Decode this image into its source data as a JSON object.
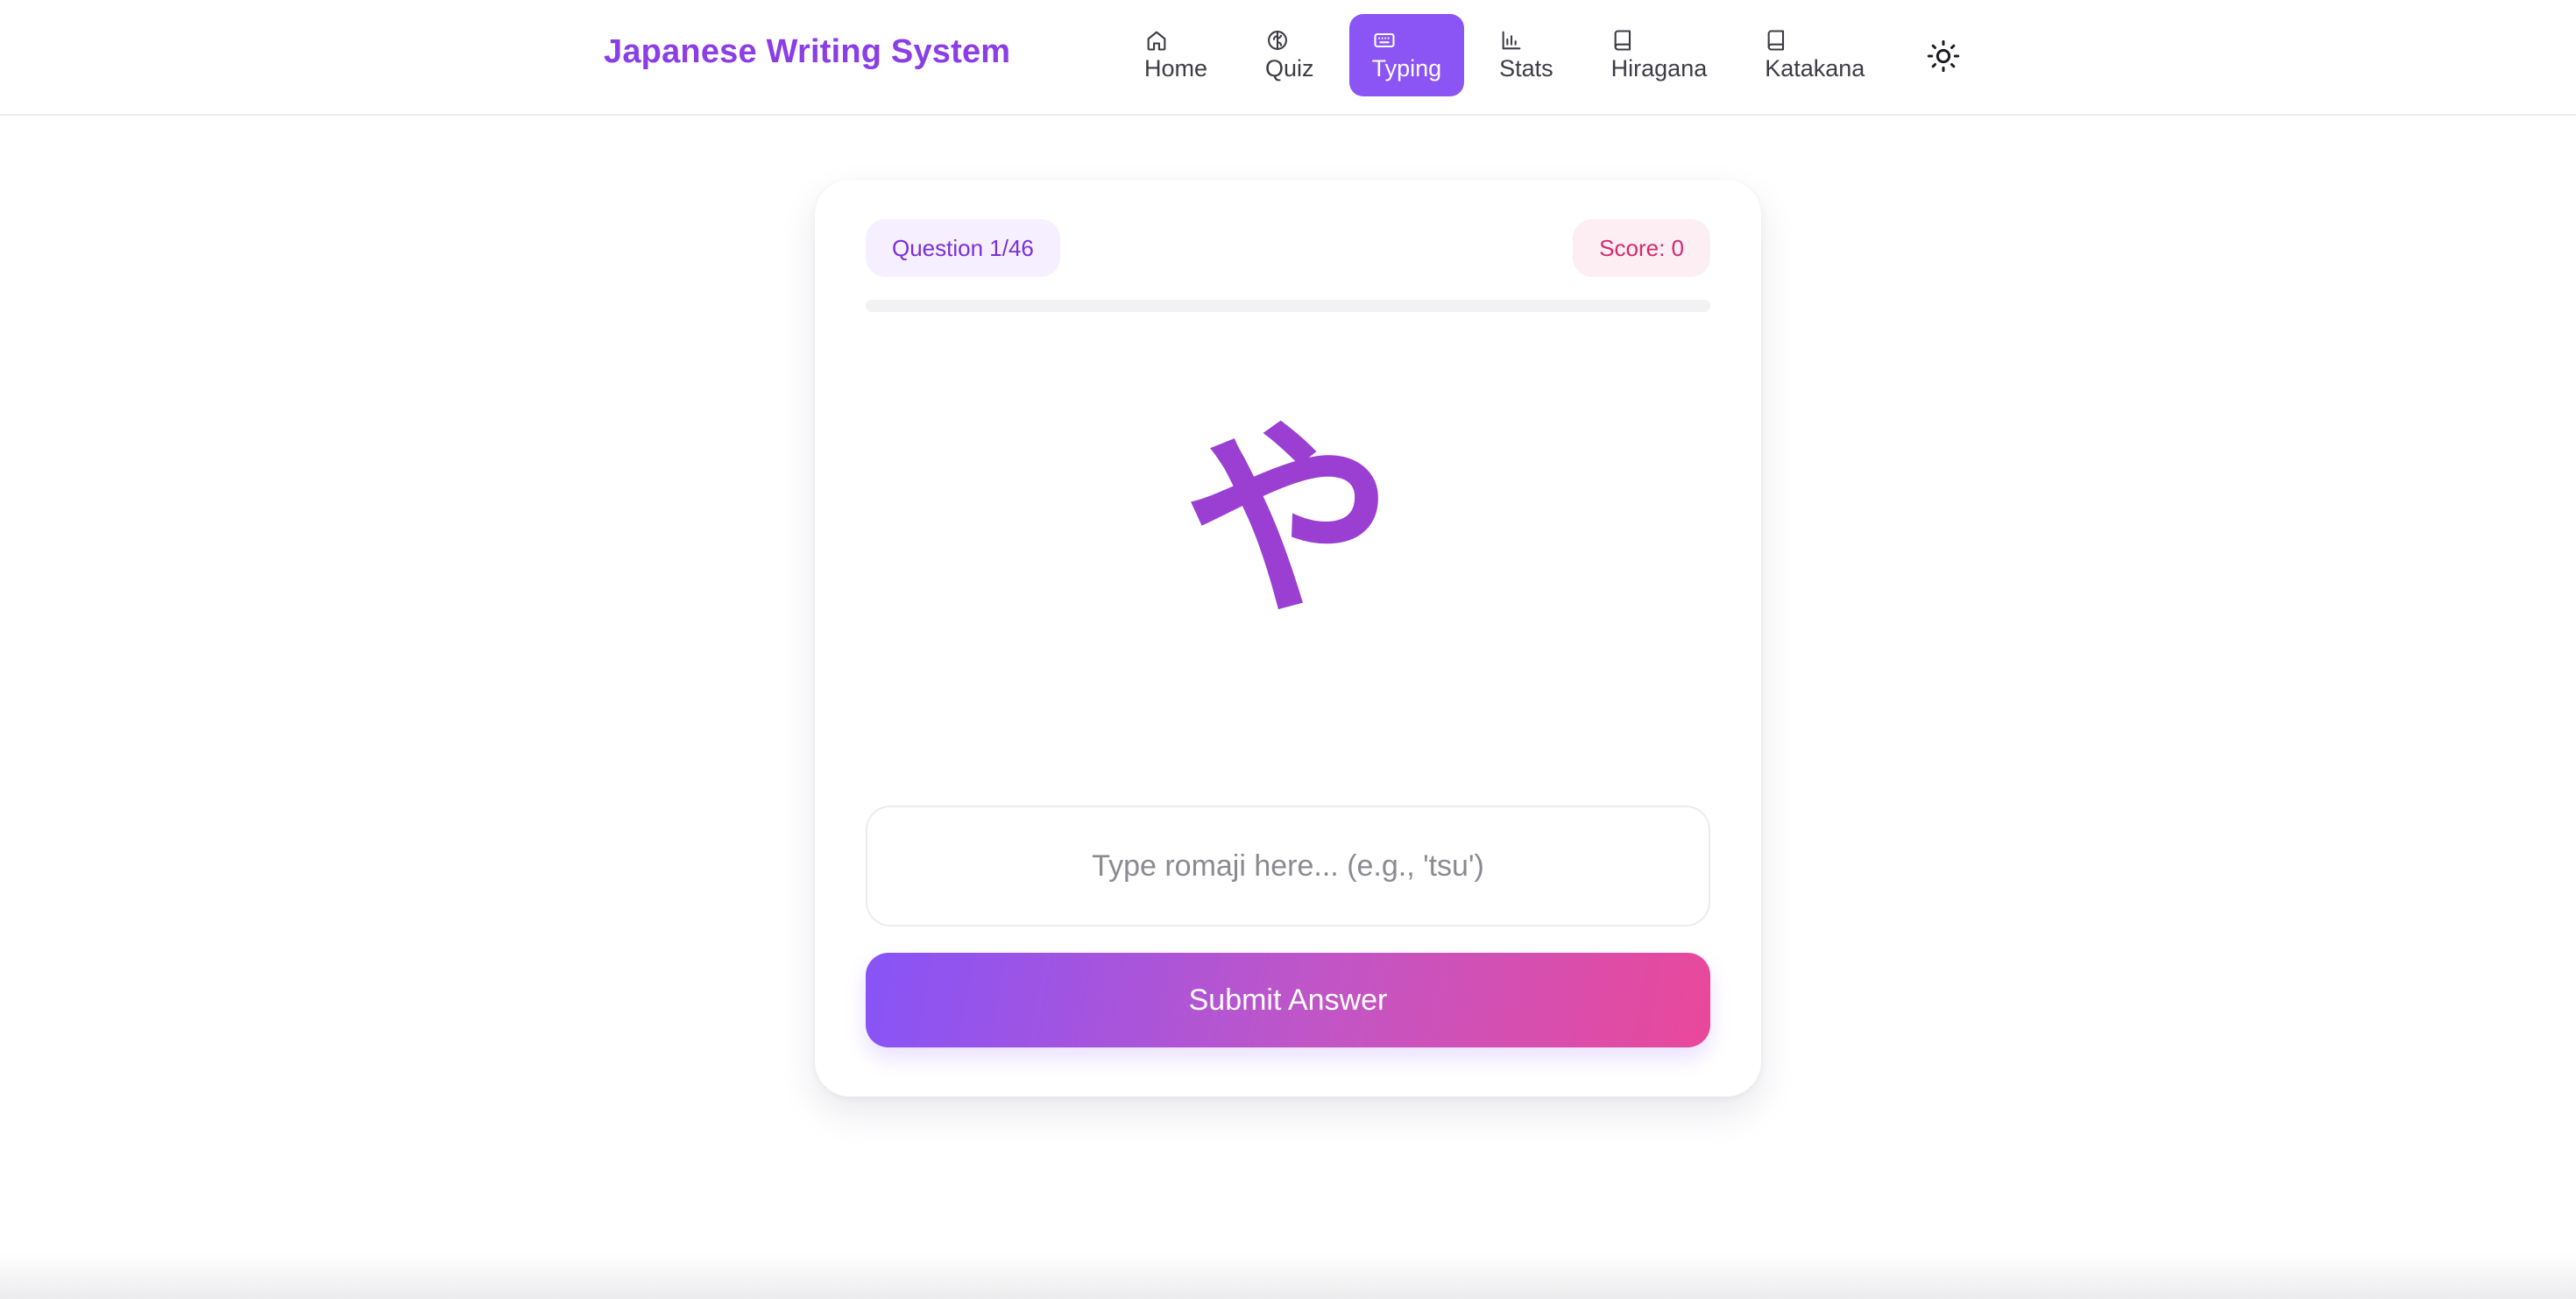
{
  "header": {
    "brand": "Japanese Writing System",
    "nav": [
      {
        "label": "Home",
        "icon": "home-icon"
      },
      {
        "label": "Quiz",
        "icon": "brain-icon"
      },
      {
        "label": "Typing",
        "icon": "keyboard-icon",
        "active": true
      },
      {
        "label": "Stats",
        "icon": "bar-chart-icon"
      },
      {
        "label": "Hiragana",
        "icon": "book-icon"
      },
      {
        "label": "Katakana",
        "icon": "book-icon"
      }
    ],
    "theme_icon": "sun-icon"
  },
  "quiz": {
    "question_label": "Question 1/46",
    "score_label": "Score: 0",
    "progress_fraction": 0,
    "character": "や",
    "input_placeholder": "Type romaji here... (e.g., 'tsu')",
    "input_value": "",
    "submit_label": "Submit Answer"
  },
  "colors": {
    "brand": "#8b3ee6",
    "accent": "#8b55f5",
    "pink": "#e8478f"
  }
}
